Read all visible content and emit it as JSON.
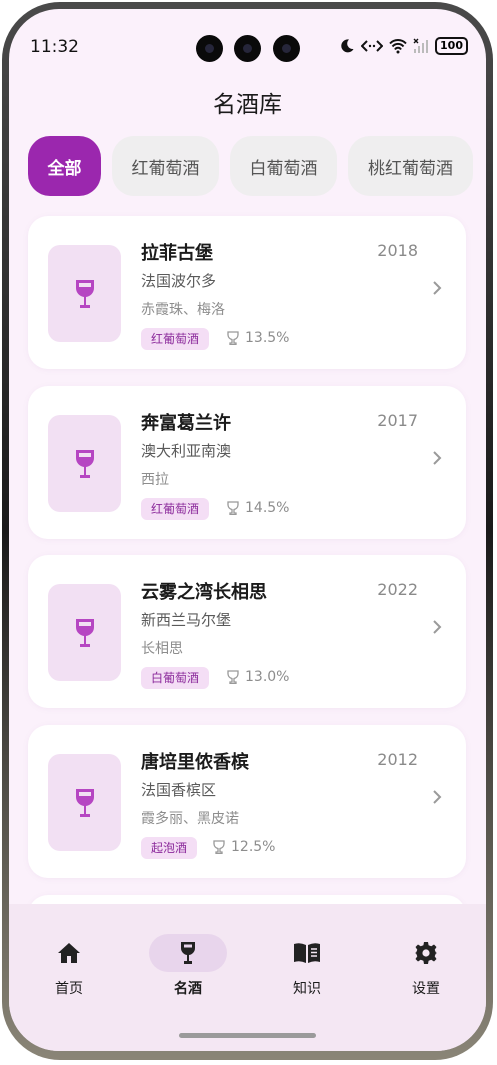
{
  "status_bar": {
    "time": "11:32",
    "battery": "100"
  },
  "page": {
    "title": "名酒库"
  },
  "filters": [
    {
      "label": "全部",
      "active": true
    },
    {
      "label": "红葡萄酒",
      "active": false
    },
    {
      "label": "白葡萄酒",
      "active": false
    },
    {
      "label": "桃红葡萄酒",
      "active": false
    }
  ],
  "wines": [
    {
      "name": "拉菲古堡",
      "year": "2018",
      "region": "法国波尔多",
      "grapes": "赤霞珠、梅洛",
      "type": "红葡萄酒",
      "abv": "13.5%"
    },
    {
      "name": "奔富葛兰许",
      "year": "2017",
      "region": "澳大利亚南澳",
      "grapes": "西拉",
      "type": "红葡萄酒",
      "abv": "14.5%"
    },
    {
      "name": "云雾之湾长相思",
      "year": "2022",
      "region": "新西兰马尔堡",
      "grapes": "长相思",
      "type": "白葡萄酒",
      "abv": "13.0%"
    },
    {
      "name": "唐培里侬香槟",
      "year": "2012",
      "region": "法国香槟区",
      "grapes": "霞多丽、黑皮诺",
      "type": "起泡酒",
      "abv": "12.5%"
    }
  ],
  "nav": [
    {
      "label": "首页",
      "icon": "home-icon",
      "active": false
    },
    {
      "label": "名酒",
      "icon": "wine-glass-icon",
      "active": true
    },
    {
      "label": "知识",
      "icon": "book-icon",
      "active": false
    },
    {
      "label": "设置",
      "icon": "gear-icon",
      "active": false
    }
  ],
  "colors": {
    "accent": "#9b27ae",
    "tag_bg": "#f4def5",
    "background": "#fbf1fb"
  }
}
